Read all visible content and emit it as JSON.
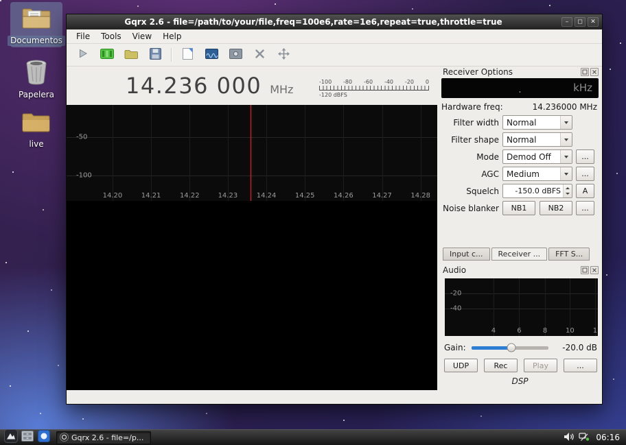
{
  "desktop": {
    "icons": [
      {
        "label": "Documentos"
      },
      {
        "label": "Papelera"
      },
      {
        "label": "live"
      }
    ]
  },
  "window": {
    "title": "Gqrx 2.6 - file=/path/to/your/file,freq=100e6,rate=1e6,repeat=true,throttle=true",
    "menu": [
      "File",
      "Tools",
      "View",
      "Help"
    ],
    "buttons": {
      "minimize": "–",
      "maximize": "◻",
      "close": "✕"
    }
  },
  "freq_display": {
    "digits": "14.236 000",
    "unit": "MHz"
  },
  "level_meter": {
    "ticks": [
      "-100",
      "-80",
      "-60",
      "-40",
      "-20",
      "0"
    ],
    "floor_label": "-120 dBFS"
  },
  "spectrum": {
    "y_ticks": [
      "-50",
      "-100"
    ],
    "x_ticks": [
      "14.20",
      "14.21",
      "14.22",
      "14.23",
      "14.24",
      "14.25",
      "14.26",
      "14.27",
      "14.28"
    ]
  },
  "receiver": {
    "title": "Receiver Options",
    "lcd": {
      "unit": "kHz",
      "dim_point": "."
    },
    "hardware_freq": {
      "label": "Hardware freq:",
      "value": "14.236000 MHz"
    },
    "filter_width": {
      "label": "Filter width",
      "value": "Normal"
    },
    "filter_shape": {
      "label": "Filter shape",
      "value": "Normal"
    },
    "mode": {
      "label": "Mode",
      "value": "Demod Off",
      "more": "..."
    },
    "agc": {
      "label": "AGC",
      "value": "Medium",
      "more": "..."
    },
    "squelch": {
      "label": "Squelch",
      "value": "-150.0 dBFS",
      "auto": "A"
    },
    "noise_blanker": {
      "label": "Noise blanker",
      "nb1": "NB1",
      "nb2": "NB2",
      "more": "..."
    }
  },
  "dock_tabs": [
    {
      "label": "Input c..."
    },
    {
      "label": "Receiver ..."
    },
    {
      "label": "FFT S..."
    }
  ],
  "audio": {
    "title": "Audio",
    "y_ticks": [
      "-20",
      "-40"
    ],
    "x_ticks": [
      "4",
      "6",
      "8",
      "10",
      "1"
    ],
    "gain": {
      "label": "Gain:",
      "value": "-20.0 dB"
    },
    "buttons": {
      "udp": "UDP",
      "rec": "Rec",
      "play": "Play",
      "more": "..."
    },
    "footer": "DSP"
  },
  "taskbar": {
    "task": "Gqrx 2.6 - file=/p...",
    "clock": "06:16"
  }
}
